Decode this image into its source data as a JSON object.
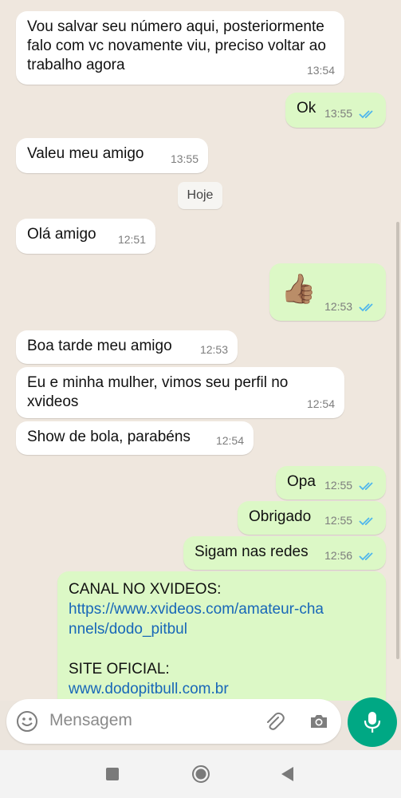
{
  "messages": [
    {
      "text": "Vou salvar seu número aqui, posteriormente falo com vc novamente viu, preciso voltar ao trabalho agora",
      "time": "13:54"
    },
    {
      "text": "Ok",
      "time": "13:55"
    },
    {
      "text": "Valeu meu amigo",
      "time": "13:55"
    },
    {
      "text": "Olá amigo",
      "time": "12:51"
    },
    {
      "text": "👍🏽",
      "time": "12:53"
    },
    {
      "text": "Boa tarde meu amigo",
      "time": "12:53"
    },
    {
      "text": "Eu e minha mulher, vimos seu perfil no xvideos",
      "time": "12:54"
    },
    {
      "text": "Show de bola, parabéns",
      "time": "12:54"
    },
    {
      "text": "Opa",
      "time": "12:55"
    },
    {
      "text": "Obrigado",
      "time": "12:55"
    },
    {
      "text": "Sigam nas redes",
      "time": "12:56"
    }
  ],
  "promo": {
    "line1": "CANAL NO XVIDEOS:",
    "link1": "https://www.xvideos.com/amateur-channels/dodo_pitbul",
    "line2": "SITE OFICIAL:",
    "link2": "www.dodopitbull.com.br"
  },
  "date_divider": "Hoje",
  "composer": {
    "placeholder": "Mensagem"
  },
  "colors": {
    "incoming": "#ffffff",
    "outgoing": "#dcf8c6",
    "accent": "#00a884",
    "read_ticks": "#4fb6ec"
  },
  "icons": [
    "emoji-icon",
    "attach-icon",
    "camera-icon",
    "mic-icon",
    "nav-recents-icon",
    "nav-home-icon",
    "nav-back-icon"
  ]
}
